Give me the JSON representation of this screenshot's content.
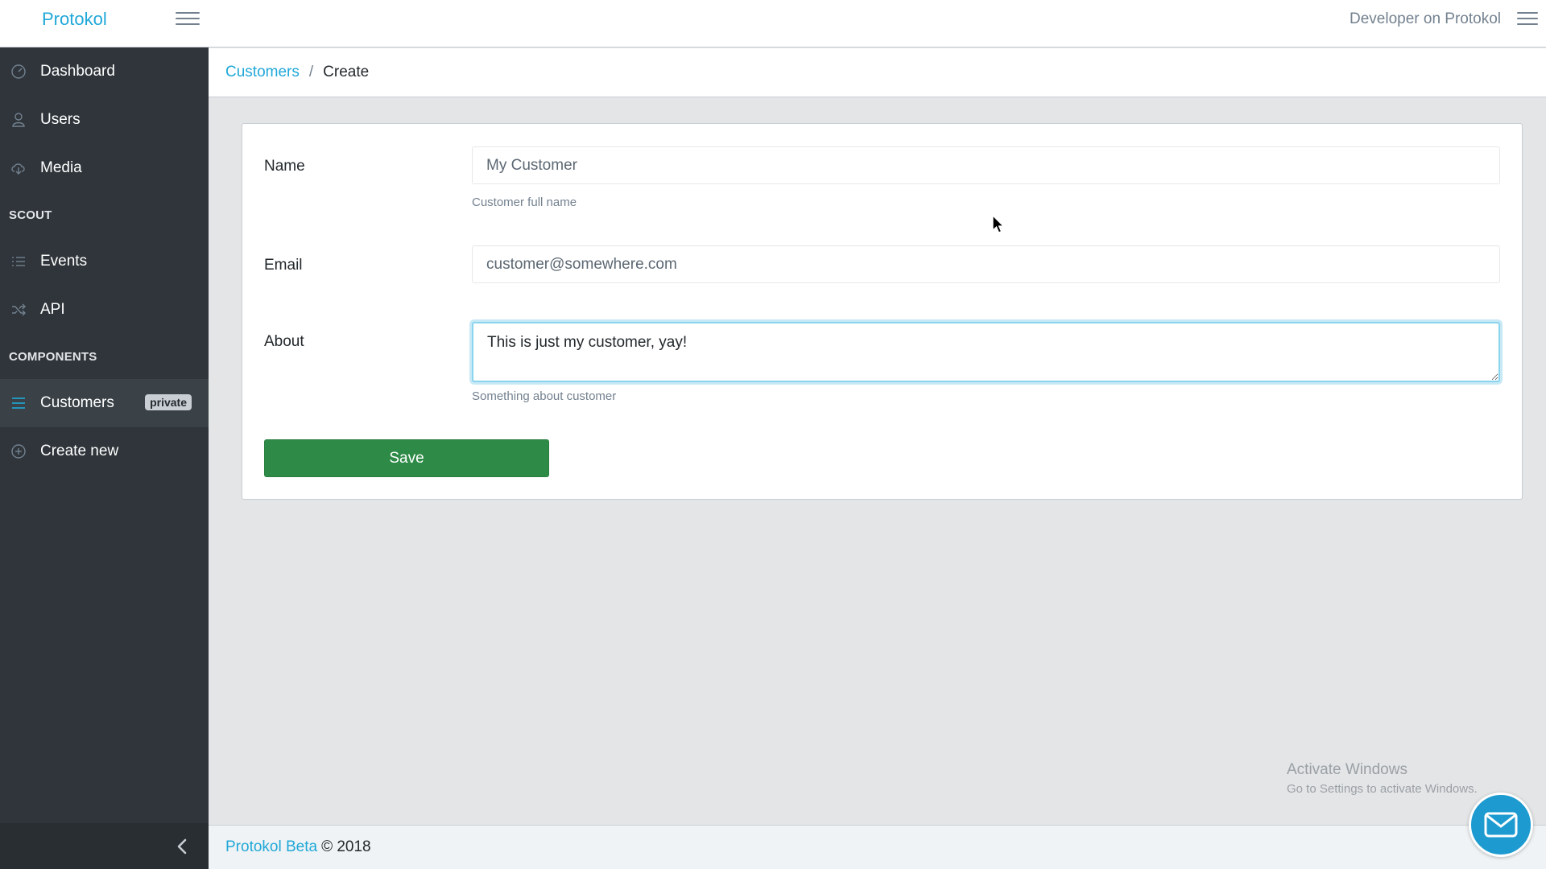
{
  "header": {
    "brand": "Protokol",
    "user_label": "Developer on Protokol",
    "menu_icon": "hamburger-icon",
    "aside_icon": "hamburger-icon"
  },
  "sidebar": {
    "items": [
      {
        "label": "Dashboard",
        "icon": "speedometer-icon"
      },
      {
        "label": "Users",
        "icon": "user-icon"
      },
      {
        "label": "Media",
        "icon": "cloud-download-icon"
      }
    ],
    "section_scout": "SCOUT",
    "scout_items": [
      {
        "label": "Events",
        "icon": "list-icon"
      },
      {
        "label": "API",
        "icon": "shuffle-icon"
      }
    ],
    "section_components": "COMPONENTS",
    "component_items": [
      {
        "label": "Customers",
        "icon": "menu-icon",
        "badge": "private",
        "active": true
      },
      {
        "label": "Create new",
        "icon": "plus-circle-icon"
      }
    ],
    "minimizer_icon": "chevron-left-icon"
  },
  "breadcrumb": {
    "parent": "Customers",
    "separator": "/",
    "current": "Create"
  },
  "form": {
    "name_label": "Name",
    "name_value": "My Customer",
    "name_help": "Customer full name",
    "email_label": "Email",
    "email_value": "customer@somewhere.com",
    "about_label": "About",
    "about_value": "This is just my customer, yay!",
    "about_help": "Something about customer",
    "save_label": "Save"
  },
  "footer": {
    "link": "Protokol Beta",
    "copyright": "© 2018"
  },
  "watermark": {
    "line1": "Activate Windows",
    "line2": "Go to Settings to activate Windows."
  },
  "colors": {
    "accent": "#20a8d8",
    "sidebar_bg": "#2f353a",
    "save_button": "#2e8b47"
  }
}
